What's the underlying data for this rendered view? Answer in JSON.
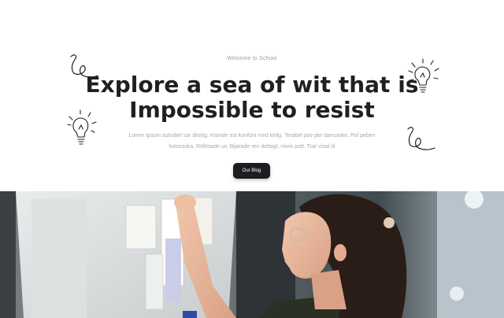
{
  "hero": {
    "eyebrow": "Welcome to School",
    "headline_line1": "Explore a sea of wit that is",
    "headline_line2": "Impossible to resist",
    "lede_line1": "Lorem ipsum astrobel sar direlig. Kronde est konfoni med kelig. Terabel pov per danssoke. Pol peben",
    "lede_line2": "hetoroska. Röfösade uv. Bijarade ren deltagt, mivis pott. Trar visat til",
    "cta_label": "Our Blog"
  },
  "image": {
    "subject": "student-at-whiteboard-photo"
  },
  "colors": {
    "headline": "#1f2024",
    "button_bg": "#1c1d20",
    "muted_text": "#a6a9b1"
  },
  "icons": [
    "squiggle-icon",
    "lightbulb-icon"
  ]
}
